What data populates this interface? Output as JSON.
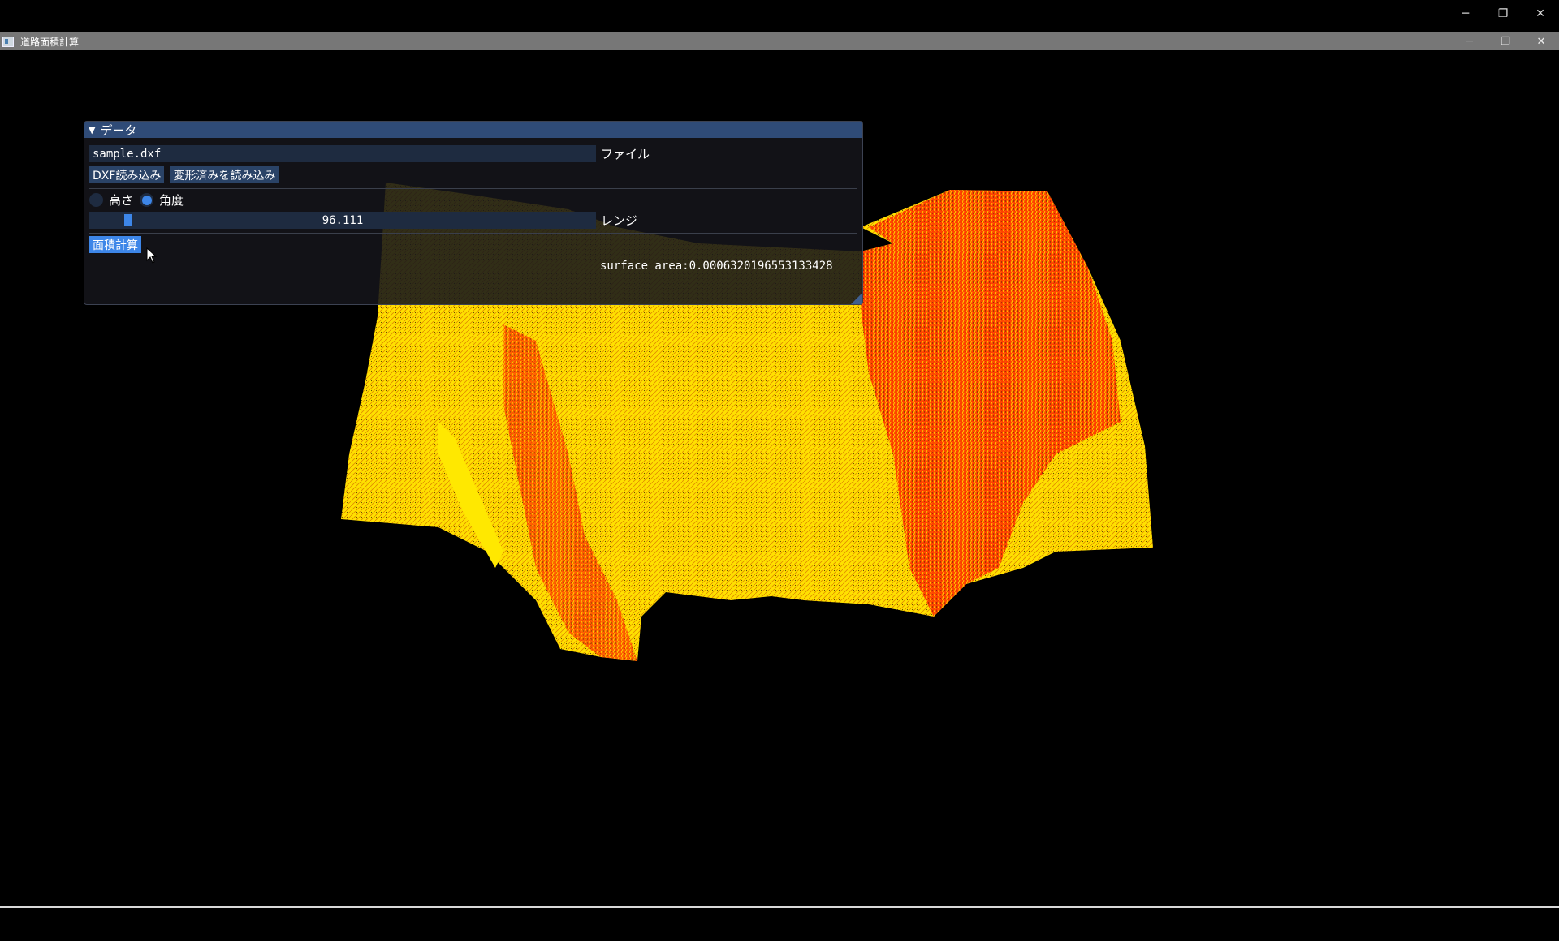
{
  "outer_window": {
    "controls": {
      "minimize": "─",
      "restore": "❐",
      "close": "✕"
    }
  },
  "app": {
    "title": "道路面積計算",
    "controls": {
      "minimize": "─",
      "restore": "❐",
      "close": "✕"
    }
  },
  "panel": {
    "header": "データ",
    "file": {
      "value": "sample.dxf",
      "label": "ファイル"
    },
    "buttons": {
      "load_dxf": "DXF読み込み",
      "load_transformed": "変形済みを読み込み",
      "compute_area": "面積計算"
    },
    "mode": {
      "options": [
        "高さ",
        "角度"
      ],
      "selected": "角度"
    },
    "range": {
      "value": "96.111",
      "label": "レンジ",
      "fraction": 0.07
    },
    "result": {
      "text": "surface area:0.0006320196553133428"
    }
  },
  "colors": {
    "panel_header": "#2f4b77",
    "accent": "#3d86e8",
    "field_bg": "#1e2b40",
    "mesh_primary": "#ffe000",
    "mesh_secondary": "#ff1a00"
  }
}
